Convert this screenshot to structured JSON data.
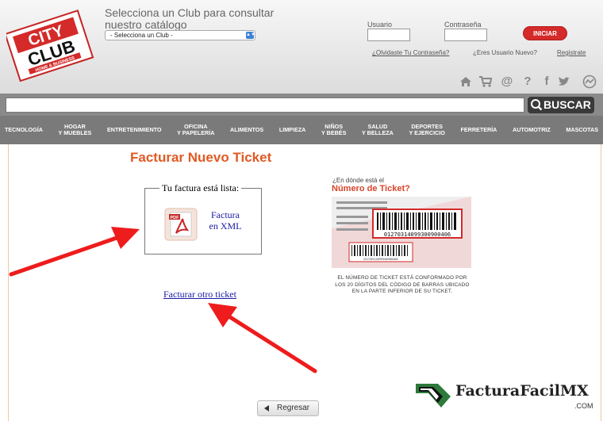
{
  "header": {
    "logo": {
      "line1": "CITY",
      "line2": "CLUB",
      "line3": "HOME & BUSINESS"
    },
    "club_prompt": "Selecciona un Club para consultar nuestro catálogo",
    "club_select_value": "- Selecciona un Club -",
    "login": {
      "usuario_label": "Usuario",
      "contrasena_label": "Contraseña",
      "iniciar_label": "INICIAR",
      "forgot_link": "¿Olvidaste Tu Contraseña?",
      "user_link": "¿Eres Usuario Nuevo?",
      "register_link": "Registrate"
    },
    "icons": [
      "home-icon",
      "cart-icon",
      "at-icon",
      "help-icon",
      "facebook-icon",
      "twitter-icon",
      "chat-icon"
    ]
  },
  "search": {
    "button_label": "BUSCAR",
    "value": ""
  },
  "nav": {
    "items": [
      "TECNOLOGÍA",
      "HOGAR\nY MUEBLES",
      "ENTRETENIMIENTO",
      "OFICINA\nY PAPELERÍA",
      "ALIMENTOS",
      "LIMPIEZA",
      "NIÑOS\nY BEBÉS",
      "SALUD\nY BELLEZA",
      "DEPORTES\nY EJERCICIO",
      "FERRETERÍA",
      "AUTOMOTRIZ",
      "MASCOTAS"
    ]
  },
  "main": {
    "title": "Facturar Nuevo Ticket",
    "factura_box_legend": "Tu factura está lista:",
    "factura_link": "Factura en XML",
    "pdf_label": "PDF",
    "otro_ticket_link": "Facturar otro ticket",
    "ticket_question_1": "¿En dónde está el",
    "ticket_question_2": "Número de Ticket?",
    "ticket_barcode_number": "01270314099300900406",
    "ticket_desc": "EL NÚMERO DE TICKET ESTÁ CONFORMADO POR LOS 20 DÍGITOS DEL CÓDIGO DE BARRAS UBICADO EN LA PARTE INFERIOR DE SU TICKET.",
    "regresar_label": "Regresar"
  },
  "watermark": {
    "text": "FacturaFacilMX",
    "suffix": ".COM"
  },
  "colors": {
    "accent": "#e05a23",
    "brand_red": "#d42a2a",
    "link": "#1a1aa6",
    "nav_bg": "#7a7a7a"
  }
}
